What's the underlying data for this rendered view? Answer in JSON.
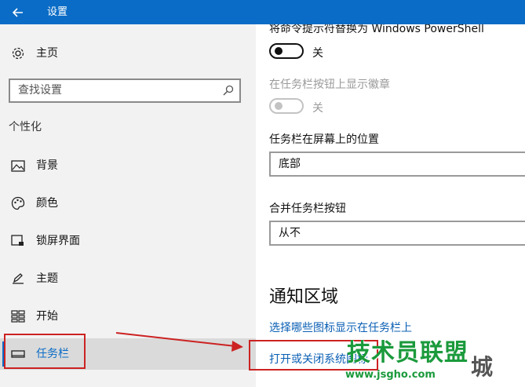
{
  "window": {
    "title": "设置"
  },
  "sidebar": {
    "home_label": "主页",
    "search_placeholder": "查找设置",
    "section_title": "个性化",
    "items": [
      {
        "label": "背景",
        "icon": "picture-icon"
      },
      {
        "label": "颜色",
        "icon": "palette-icon"
      },
      {
        "label": "锁屏界面",
        "icon": "lock-screen-icon"
      },
      {
        "label": "主题",
        "icon": "theme-brush-icon"
      },
      {
        "label": "开始",
        "icon": "start-grid-icon"
      },
      {
        "label": "任务栏",
        "icon": "taskbar-icon",
        "active": true
      }
    ]
  },
  "main": {
    "setting1": {
      "label": "将命令提示符替换为 Windows PowerShell",
      "state": "关"
    },
    "setting2": {
      "label": "在任务栏按钮上显示徽章",
      "state": "关"
    },
    "position": {
      "label": "任务栏在屏幕上的位置",
      "value": "底部"
    },
    "combine": {
      "label": "合并任务栏按钮",
      "value": "从不"
    },
    "notification": {
      "heading": "通知区域",
      "link1": "选择哪些图标显示在任务栏上",
      "link2": "打开或关闭系统图标"
    }
  },
  "watermark": {
    "title": "技术员联盟",
    "url": "www.jsgho.com",
    "logo": "城"
  },
  "colors": {
    "accent": "#0a6cc6",
    "annotation": "#cc2222",
    "watermark": "#1b9a3c"
  }
}
